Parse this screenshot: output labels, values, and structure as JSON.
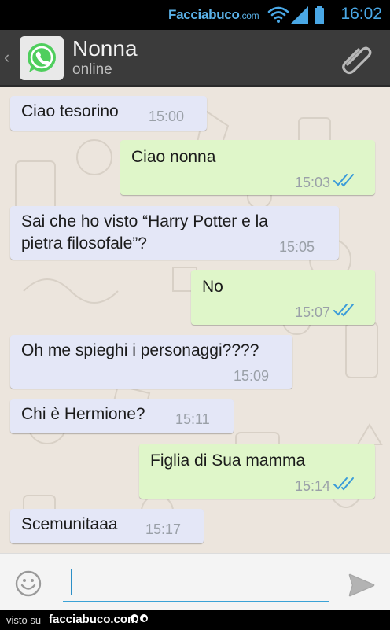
{
  "status_bar": {
    "watermark_main": "Facciabuco",
    "watermark_tld": ".com",
    "clock": "16:02",
    "icons": [
      "wifi-icon",
      "signal-icon",
      "battery-icon"
    ]
  },
  "header": {
    "contact_name": "Nonna",
    "contact_status": "online",
    "icons": [
      "back-chevron-icon",
      "whatsapp-logo",
      "paperclip-icon"
    ]
  },
  "messages": [
    {
      "direction": "in",
      "lines": [
        "Ciao tesorino"
      ],
      "time": "15:00"
    },
    {
      "direction": "out",
      "lines": [
        "Ciao nonna"
      ],
      "time": "15:03",
      "ticks": "read"
    },
    {
      "direction": "in",
      "lines": [
        "Sai che ho visto “Harry Potter e la",
        "pietra filosofale”?"
      ],
      "time": "15:05"
    },
    {
      "direction": "out",
      "lines": [
        "No"
      ],
      "time": "15:07",
      "ticks": "read"
    },
    {
      "direction": "in",
      "lines": [
        "Oh me spieghi i personaggi????"
      ],
      "time": "15:09"
    },
    {
      "direction": "in",
      "lines": [
        "Chi è Hermione?"
      ],
      "time": "15:11"
    },
    {
      "direction": "out",
      "lines": [
        "Figlia di Sua mamma"
      ],
      "time": "15:14",
      "ticks": "read"
    },
    {
      "direction": "in",
      "lines": [
        "Scemunitaaa"
      ],
      "time": "15:17"
    }
  ],
  "composer": {
    "value": "",
    "icons": [
      "emoji-icon",
      "send-icon"
    ]
  },
  "footer": {
    "prefix": "visto su",
    "site": "facciabuco.com"
  },
  "colors": {
    "incoming_bubble": "#e4e7f7",
    "outgoing_bubble": "#dff6c9",
    "read_ticks": "#3a9bd9",
    "accent": "#3aa2d6"
  }
}
